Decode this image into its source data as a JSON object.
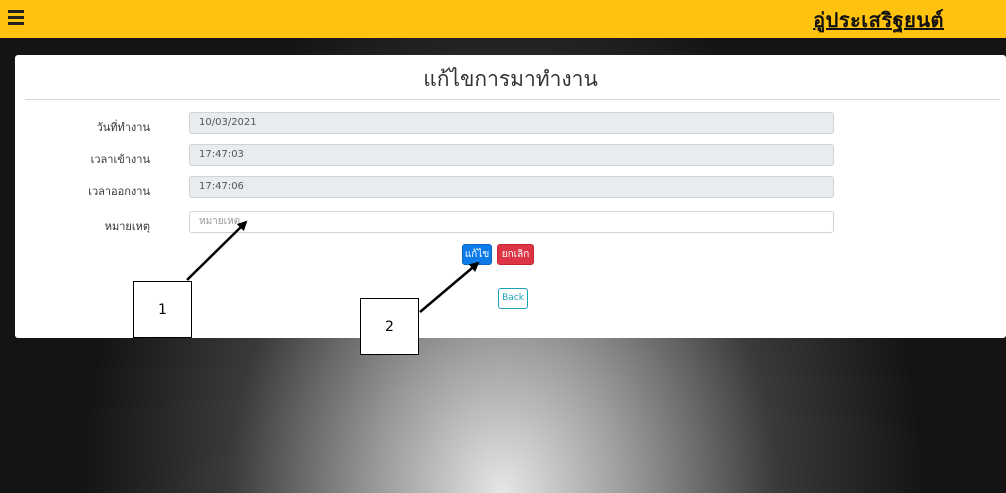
{
  "header": {
    "brand": "อู่ประเสริฐยนต์",
    "bar_color": "#ffc20e"
  },
  "form": {
    "title": "แก้ไขการมาทำงาน",
    "fields": [
      {
        "label": "วันที่ทำงาน",
        "value": "10/03/2021"
      },
      {
        "label": "เวลาเข้างาน",
        "value": "17:47:03"
      },
      {
        "label": "เวลาออกงาน",
        "value": "17:47:06"
      },
      {
        "label": "หมายเหตุ",
        "value": "",
        "placeholder": "หมายเหตุ"
      }
    ],
    "buttons": {
      "edit": "แก้ไข",
      "cancel": "ยกเลิก",
      "back": "Back"
    }
  },
  "annotations": {
    "callout_1": "1",
    "callout_2": "2"
  },
  "colors": {
    "edit_button": "#0d7be8",
    "cancel_button": "#dc3545",
    "back_button_border": "#17a2b8"
  }
}
